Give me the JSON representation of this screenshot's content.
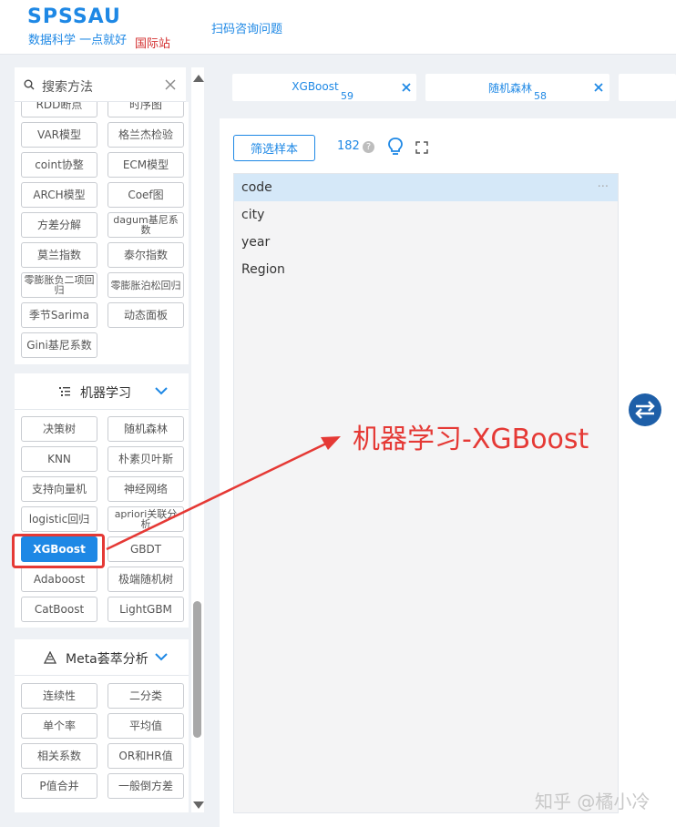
{
  "header": {
    "logo": "SPSSAU",
    "slogan": "数据科学 一点就好",
    "intl": "国际站",
    "scan_link": "扫码咨询问题"
  },
  "search": {
    "placeholder": "搜索方法"
  },
  "top_buttons": [
    "RDD断点",
    "时序图"
  ],
  "grid1": [
    [
      "VAR模型",
      "格兰杰检验"
    ],
    [
      "coint协整",
      "ECM模型"
    ],
    [
      "ARCH模型",
      "Coef图"
    ],
    [
      "方差分解",
      "dagum基尼系数"
    ],
    [
      "莫兰指数",
      "泰尔指数"
    ],
    [
      "零膨胀负二项回归",
      "零膨胀泊松回归"
    ],
    [
      "季节Sarima",
      "动态面板"
    ],
    [
      "Gini基尼系数",
      ""
    ]
  ],
  "section_ml": {
    "label": "机器学习",
    "buttons": [
      [
        "决策树",
        "随机森林"
      ],
      [
        "KNN",
        "朴素贝叶斯"
      ],
      [
        "支持向量机",
        "神经网络"
      ],
      [
        "logistic回归",
        "apriori关联分析"
      ],
      [
        "XGBoost",
        "GBDT"
      ],
      [
        "Adaboost",
        "极端随机树"
      ],
      [
        "CatBoost",
        "LightGBM"
      ]
    ]
  },
  "section_meta": {
    "label": "Meta荟萃分析",
    "buttons": [
      [
        "连续性",
        "二分类"
      ],
      [
        "单个率",
        "平均值"
      ],
      [
        "相关系数",
        "OR和HR值"
      ],
      [
        "P值合并",
        "一般倒方差"
      ]
    ]
  },
  "tabs": [
    {
      "label": "XGBoost",
      "count": "59"
    },
    {
      "label": "随机森林",
      "count": "58"
    }
  ],
  "main": {
    "filter_label": "筛选样本",
    "count": "182",
    "help": "?"
  },
  "variables": [
    "code",
    "city",
    "year",
    "Region"
  ],
  "more": "···",
  "annotation": "机器学习-XGBoost",
  "watermark": "知乎 @橘小冷",
  "colors": {
    "accent": "#1e88e5",
    "annotation": "#e53935",
    "selected_row": "#d5e8f8"
  }
}
